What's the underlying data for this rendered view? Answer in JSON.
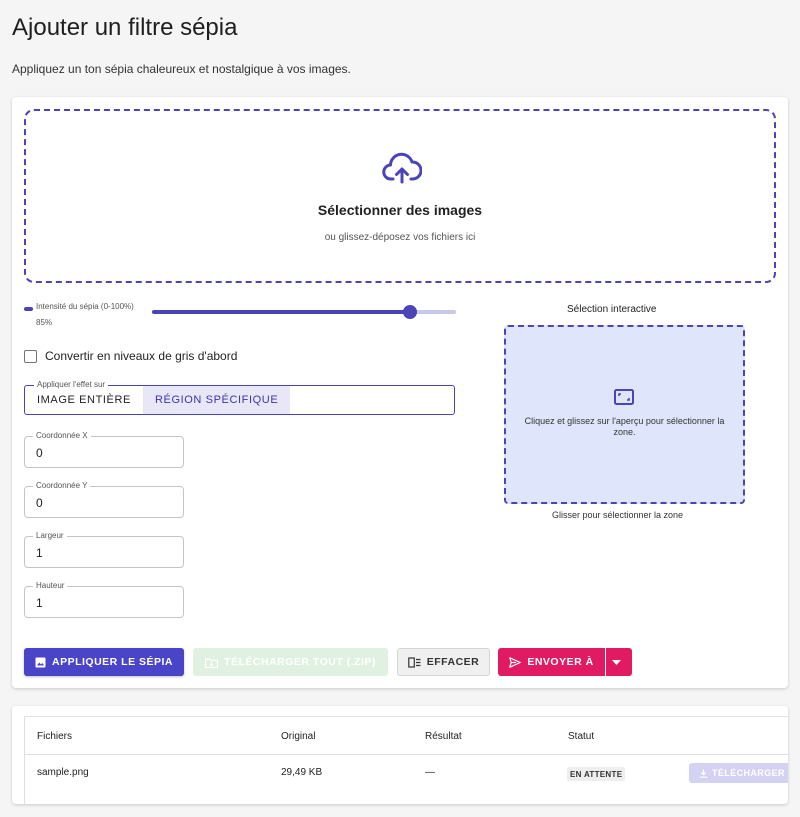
{
  "header": {
    "title": "Ajouter un filtre sépia",
    "subtitle": "Appliquez un ton sépia chaleureux et nostalgique à vos images."
  },
  "dropzone": {
    "icon": "cloud-upload-icon",
    "title": "Sélectionner des images",
    "subtitle": "ou glissez-déposez vos fichiers ici"
  },
  "slider": {
    "label": "Intensité du sépia (0-100%)",
    "value_label": "85%",
    "value": 85
  },
  "grayscale": {
    "label": "Convertir en niveaux de gris d'abord",
    "checked": false
  },
  "apply_to": {
    "legend": "Appliquer l'effet sur",
    "options": [
      "IMAGE ENTIÈRE",
      "RÉGION SPÉCIFIQUE"
    ],
    "selected": "RÉGION SPÉCIFIQUE"
  },
  "fields": [
    {
      "label": "Coordonnée X",
      "value": "0"
    },
    {
      "label": "Coordonnée Y",
      "value": "0"
    },
    {
      "label": "Largeur",
      "value": "1"
    },
    {
      "label": "Hauteur",
      "value": "1"
    }
  ],
  "selection": {
    "title": "Sélection interactive",
    "icon": "crop-frame-icon",
    "hint": "Cliquez et glissez sur l'aperçu pour sélectionner la zone.",
    "caption": "Glisser pour sélectionner la zone"
  },
  "actions": {
    "apply": "APPLIQUER LE SÉPIA",
    "download_all": "TÉLÉCHARGER TOUT (.ZIP)",
    "clear": "EFFACER",
    "send_to": "ENVOYER À"
  },
  "files_table": {
    "headers": [
      "Fichiers",
      "Original",
      "Résultat",
      "Statut"
    ],
    "rows": [
      {
        "name": "sample.png",
        "original": "29,49 KB",
        "result": "—",
        "status": "EN ATTENTE",
        "action": "TÉLÉCHARGER"
      }
    ]
  },
  "colors": {
    "primary": "#4a44c8",
    "accent": "#e01b63",
    "selection_bg": "#dfe6fb"
  }
}
